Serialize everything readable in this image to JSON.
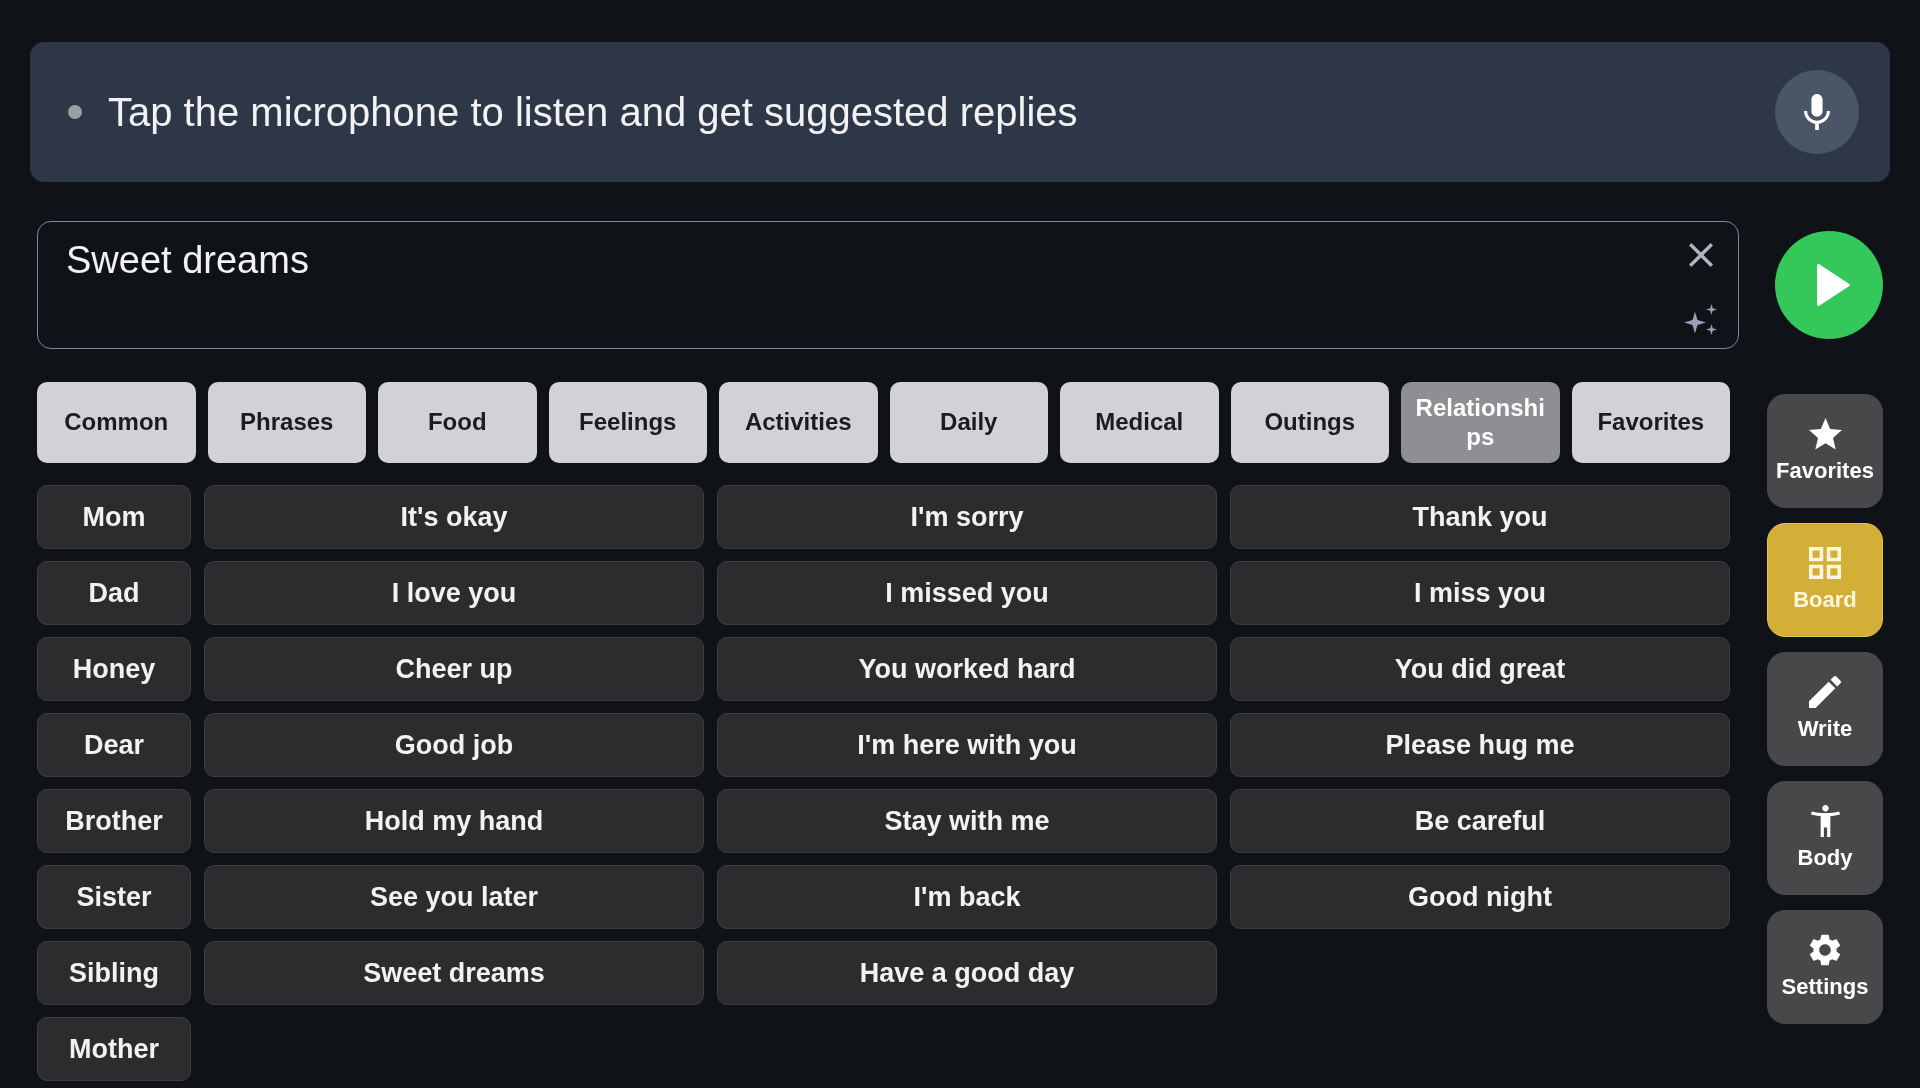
{
  "banner": {
    "listening": false,
    "message": "Tap the microphone to listen and get suggested replies"
  },
  "message_field": {
    "value": "Sweet dreams"
  },
  "categories": [
    {
      "label": "Common",
      "selected": false
    },
    {
      "label": "Phrases",
      "selected": false
    },
    {
      "label": "Food",
      "selected": false
    },
    {
      "label": "Feelings",
      "selected": false
    },
    {
      "label": "Activities",
      "selected": false
    },
    {
      "label": "Daily",
      "selected": false
    },
    {
      "label": "Medical",
      "selected": false
    },
    {
      "label": "Outings",
      "selected": false
    },
    {
      "label": "Relationships",
      "selected": true
    },
    {
      "label": "Favorites",
      "selected": false
    }
  ],
  "names": [
    "Mom",
    "Dad",
    "Honey",
    "Dear",
    "Brother",
    "Sister",
    "Sibling",
    "Mother"
  ],
  "phrases": [
    "It's okay",
    "I'm sorry",
    "Thank you",
    "I love you",
    "I missed you",
    "I miss you",
    "Cheer up",
    "You worked hard",
    "You did great",
    "Good job",
    "I'm here with you",
    "Please hug me",
    "Hold my hand",
    "Stay with me",
    "Be careful",
    "See you later",
    "I'm back",
    "Good night",
    "Sweet dreams",
    "Have a good day"
  ],
  "sidebar": {
    "items": [
      {
        "label": "Favorites",
        "selected": false
      },
      {
        "label": "Board",
        "selected": true
      },
      {
        "label": "Write",
        "selected": false
      },
      {
        "label": "Body",
        "selected": false
      },
      {
        "label": "Settings",
        "selected": false
      }
    ]
  }
}
